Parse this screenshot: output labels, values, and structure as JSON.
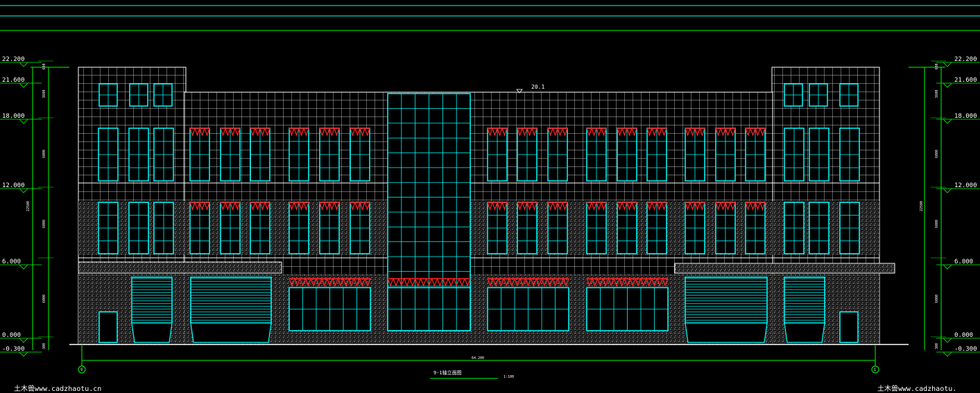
{
  "drawing": {
    "title": "9-1轴立面图",
    "scale": "1:100",
    "total_length": "64.200",
    "roof_mark": "20.1",
    "axis_left": "9",
    "axis_right": "1"
  },
  "levels": {
    "left": [
      "22.200",
      "21.600",
      "18.000",
      "12.000",
      "6.000",
      "0.000",
      "-0.300"
    ],
    "right": [
      "22.200",
      "21.600",
      "18.000",
      "12.000",
      "6.000",
      "0.000",
      "-0.300"
    ]
  },
  "vertical_dims": {
    "segments": [
      "600",
      "3600",
      "6000",
      "6000",
      "6000",
      "300"
    ],
    "left_total": "22500",
    "right_total": "22500"
  },
  "watermark": {
    "left": "土木兽www.cadzhaotu.cn",
    "right": "土木兽www.cadzhaotu."
  },
  "colors": {
    "background": "#000000",
    "facade_lines": "#ffffff",
    "glazing": "#00ffff",
    "canopy": "#ff2020",
    "dimension": "#00ff00"
  }
}
